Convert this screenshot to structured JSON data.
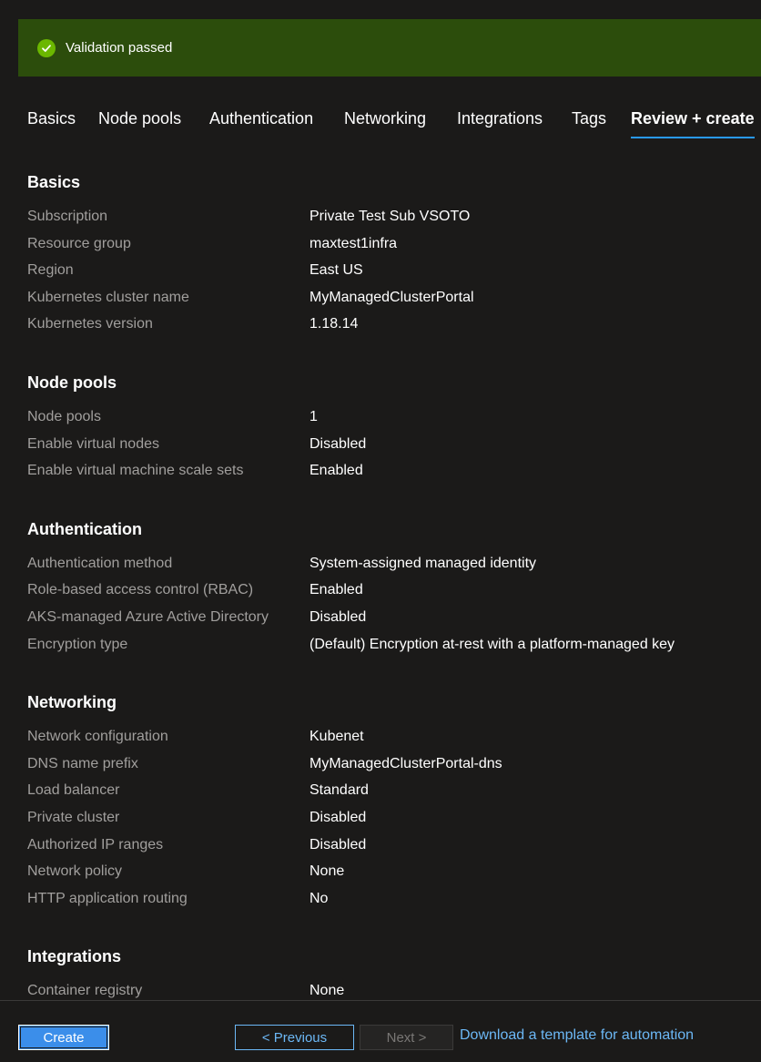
{
  "banner": {
    "text": "Validation passed",
    "icon": "check-circle-icon",
    "color": "#2c4d0c"
  },
  "tabs": [
    {
      "label": "Basics",
      "active": false
    },
    {
      "label": "Node pools",
      "active": false
    },
    {
      "label": "Authentication",
      "active": false
    },
    {
      "label": "Networking",
      "active": false
    },
    {
      "label": "Integrations",
      "active": false
    },
    {
      "label": "Tags",
      "active": false
    },
    {
      "label": "Review + create",
      "active": true
    }
  ],
  "sections": {
    "basics": {
      "title": "Basics",
      "rows": [
        {
          "label": "Subscription",
          "value": "Private Test Sub VSOTO"
        },
        {
          "label": "Resource group",
          "value": "maxtest1infra"
        },
        {
          "label": "Region",
          "value": "East US"
        },
        {
          "label": "Kubernetes cluster name",
          "value": "MyManagedClusterPortal"
        },
        {
          "label": "Kubernetes version",
          "value": "1.18.14"
        }
      ]
    },
    "node_pools": {
      "title": "Node pools",
      "rows": [
        {
          "label": "Node pools",
          "value": "1"
        },
        {
          "label": "Enable virtual nodes",
          "value": "Disabled"
        },
        {
          "label": "Enable virtual machine scale sets",
          "value": "Enabled"
        }
      ]
    },
    "authentication": {
      "title": "Authentication",
      "rows": [
        {
          "label": "Authentication method",
          "value": "System-assigned managed identity"
        },
        {
          "label": "Role-based access control (RBAC)",
          "value": "Enabled"
        },
        {
          "label": "AKS-managed Azure Active Directory",
          "value": "Disabled"
        },
        {
          "label": "Encryption type",
          "value": "(Default) Encryption at-rest with a platform-managed key"
        }
      ]
    },
    "networking": {
      "title": "Networking",
      "rows": [
        {
          "label": "Network configuration",
          "value": "Kubenet"
        },
        {
          "label": "DNS name prefix",
          "value": "MyManagedClusterPortal-dns"
        },
        {
          "label": "Load balancer",
          "value": "Standard"
        },
        {
          "label": "Private cluster",
          "value": "Disabled"
        },
        {
          "label": "Authorized IP ranges",
          "value": "Disabled"
        },
        {
          "label": "Network policy",
          "value": "None"
        },
        {
          "label": "HTTP application routing",
          "value": "No"
        }
      ]
    },
    "integrations": {
      "title": "Integrations",
      "rows": [
        {
          "label": "Container registry",
          "value": "None"
        }
      ]
    }
  },
  "footer": {
    "create_label": "Create",
    "previous_label": "< Previous",
    "next_label": "Next >",
    "download_link": "Download a template for automation"
  },
  "colors": {
    "background": "#1b1a19",
    "accent": "#2899f5",
    "link": "#6cb8f6",
    "success": "#6bb700"
  }
}
